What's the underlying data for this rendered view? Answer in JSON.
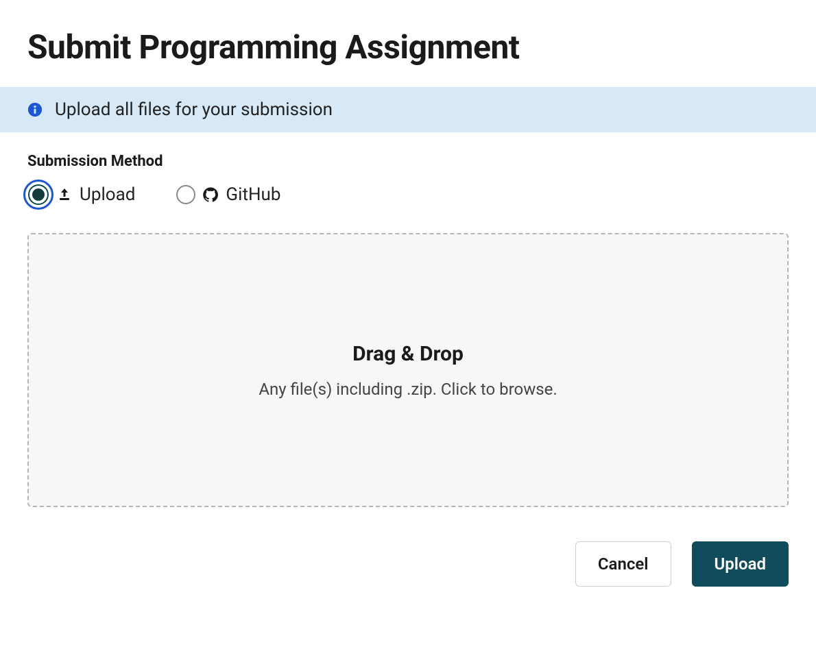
{
  "header": {
    "title": "Submit Programming Assignment"
  },
  "banner": {
    "text": "Upload all files for your submission"
  },
  "submission": {
    "section_label": "Submission Method",
    "methods": [
      {
        "label": "Upload",
        "selected": true
      },
      {
        "label": "GitHub",
        "selected": false
      }
    ]
  },
  "dropzone": {
    "title": "Drag & Drop",
    "subtitle": "Any file(s) including .zip. Click to browse."
  },
  "actions": {
    "cancel_label": "Cancel",
    "upload_label": "Upload"
  },
  "colors": {
    "banner_bg": "#d7e9f7",
    "primary_button": "#0f4c5c",
    "focus_ring": "#1a56d6"
  }
}
